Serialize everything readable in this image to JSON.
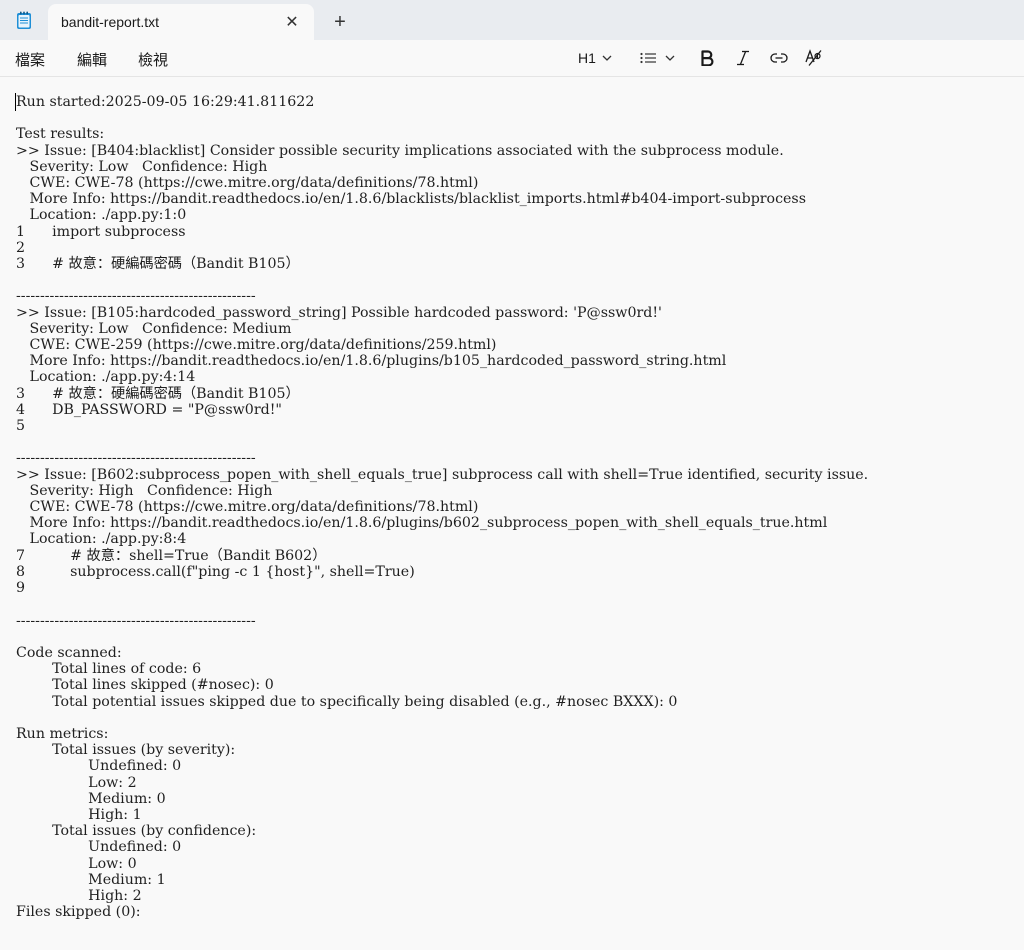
{
  "tab": {
    "title": "bandit-report.txt",
    "close_glyph": "✕",
    "new_glyph": "+"
  },
  "menu": {
    "file": "檔案",
    "edit": "編輯",
    "view": "檢視"
  },
  "toolbar": {
    "heading_label": "H1"
  },
  "document": {
    "text": "Run started:2025-09-05 16:29:41.811622\n\nTest results:\n>> Issue: [B404:blacklist] Consider possible security implications associated with the subprocess module.\n   Severity: Low   Confidence: High\n   CWE: CWE-78 (https://cwe.mitre.org/data/definitions/78.html)\n   More Info: https://bandit.readthedocs.io/en/1.8.6/blacklists/blacklist_imports.html#b404-import-subprocess\n   Location: ./app.py:1:0\n1\timport subprocess\n2\n3\t# 故意：硬編碼密碼（Bandit B105）\n\n--------------------------------------------------\n>> Issue: [B105:hardcoded_password_string] Possible hardcoded password: 'P@ssw0rd!'\n   Severity: Low   Confidence: Medium\n   CWE: CWE-259 (https://cwe.mitre.org/data/definitions/259.html)\n   More Info: https://bandit.readthedocs.io/en/1.8.6/plugins/b105_hardcoded_password_string.html\n   Location: ./app.py:4:14\n3\t# 故意：硬編碼密碼（Bandit B105）\n4\tDB_PASSWORD = \"P@ssw0rd!\"\n5\n\n--------------------------------------------------\n>> Issue: [B602:subprocess_popen_with_shell_equals_true] subprocess call with shell=True identified, security issue.\n   Severity: High   Confidence: High\n   CWE: CWE-78 (https://cwe.mitre.org/data/definitions/78.html)\n   More Info: https://bandit.readthedocs.io/en/1.8.6/plugins/b602_subprocess_popen_with_shell_equals_true.html\n   Location: ./app.py:8:4\n7\t    # 故意：shell=True（Bandit B602）\n8\t    subprocess.call(f\"ping -c 1 {host}\", shell=True)\n9\n\n--------------------------------------------------\n\nCode scanned:\n\tTotal lines of code: 6\n\tTotal lines skipped (#nosec): 0\n\tTotal potential issues skipped due to specifically being disabled (e.g., #nosec BXXX): 0\n\nRun metrics:\n\tTotal issues (by severity):\n\t\tUndefined: 0\n\t\tLow: 2\n\t\tMedium: 0\n\t\tHigh: 1\n\tTotal issues (by confidence):\n\t\tUndefined: 0\n\t\tLow: 0\n\t\tMedium: 1\n\t\tHigh: 2\nFiles skipped (0):"
  },
  "icons": {
    "app": "notepad-icon",
    "close": "close-icon",
    "new_tab": "plus-icon",
    "heading_dropdown": "chevron-down-icon",
    "list": "bulleted-list-icon",
    "bold": "bold-icon",
    "italic": "italic-icon",
    "link": "link-icon",
    "clear_formatting": "clear-formatting-icon"
  }
}
